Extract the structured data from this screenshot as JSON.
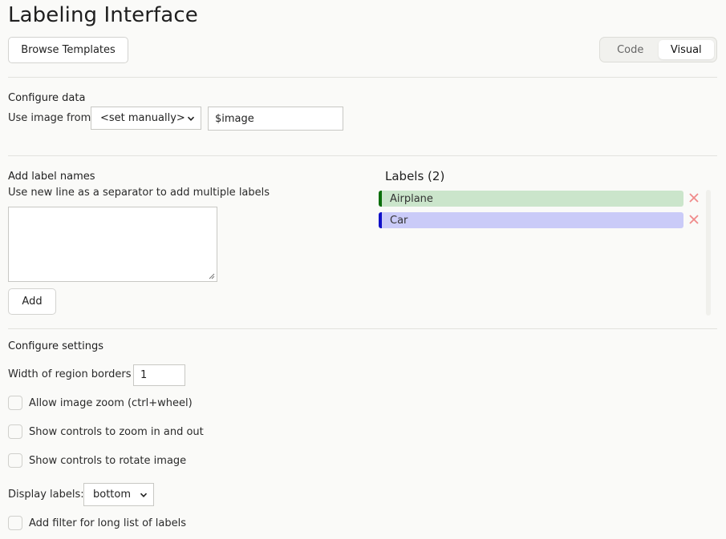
{
  "page": {
    "title": "Labeling Interface"
  },
  "header": {
    "browse_templates_label": "Browse Templates",
    "view_toggle": {
      "code_label": "Code",
      "visual_label": "Visual",
      "active": "Visual"
    }
  },
  "configure_data": {
    "heading": "Configure data",
    "use_image_from_label": "Use image from",
    "source_select_value": "<set manually>",
    "source_value": "$image"
  },
  "label_names": {
    "heading": "Add label names",
    "hint": "Use new line as a separator to add multiple labels",
    "textarea_value": "",
    "add_label": "Add"
  },
  "labels_panel": {
    "heading": "Labels (2)",
    "items": [
      {
        "name": "Airplane",
        "bar_color": "#0b6e0b",
        "bg_color": "#cbe5cb"
      },
      {
        "name": "Car",
        "bar_color": "#1010c8",
        "bg_color": "#cacbf8"
      }
    ],
    "delete_icon_color": "#f08a8a"
  },
  "settings": {
    "heading": "Configure settings",
    "border_width_label": "Width of region borders",
    "border_width_value": "1",
    "allow_zoom_label": "Allow image zoom (ctrl+wheel)",
    "zoom_controls_label": "Show controls to zoom in and out",
    "rotate_controls_label": "Show controls to rotate image",
    "display_labels_label": "Display labels:",
    "display_labels_value": "bottom",
    "filter_label": "Add filter for long list of labels"
  }
}
